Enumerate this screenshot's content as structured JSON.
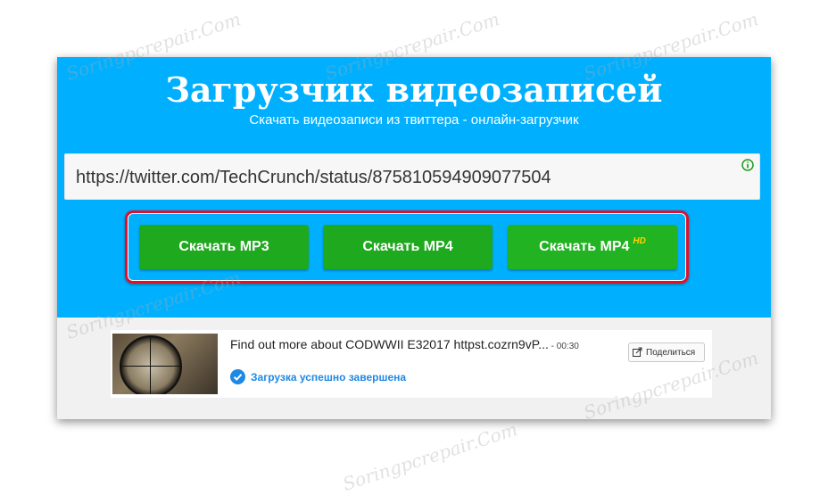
{
  "header": {
    "title": "Загрузчик видеозаписей",
    "subtitle": "Скачать видеозаписи из твиттера - онлайн-загрузчик"
  },
  "url_field": {
    "value": "https://twitter.com/TechCrunch/status/875810594909077504",
    "info_icon": "info-icon"
  },
  "buttons": {
    "mp3": "Скачать MP3",
    "mp4": "Скачать MP4",
    "mp4hd": "Скачать MP4",
    "hd_badge": "HD"
  },
  "result": {
    "title": "Find out more about CODWWII E32017 httpst.cozrn9vP...",
    "duration": " - 00:30",
    "share_label": "Поделиться",
    "status": "Загрузка успешно завершена"
  },
  "watermark": "Soringpcrepair.Com",
  "colors": {
    "hero": "#00b0ff",
    "button_green": "#1fa91f",
    "highlight_frame": "#e0102a",
    "status_blue": "#1e88e5",
    "hd_badge": "#ffd200"
  }
}
